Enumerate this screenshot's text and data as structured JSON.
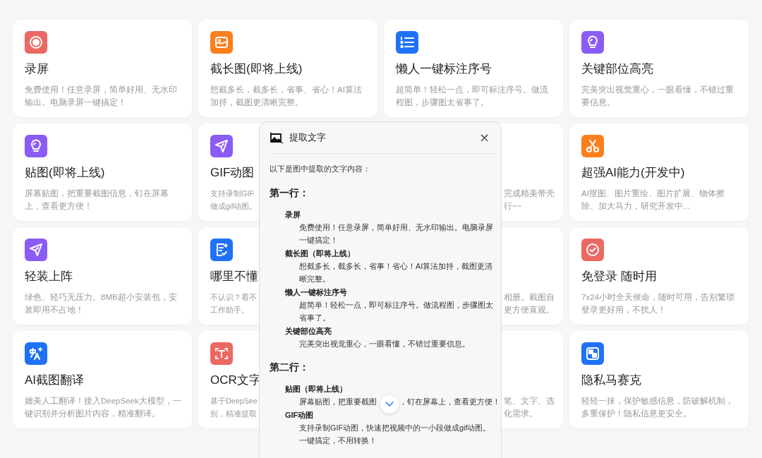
{
  "cards": [
    {
      "kind": "full",
      "color": "#eb6863",
      "title": "录屏",
      "description": "免费使用！任意录屏，简单好用、无水印输出。电脑录屏一键搞定！"
    },
    {
      "kind": "full",
      "color": "#fb7f1d",
      "title": "截长图(即将上线)",
      "description": "想截多长，截多长，省事、省心！AI算法加持，截图更清晰完整。"
    },
    {
      "kind": "full",
      "color": "#1f72f6",
      "title": "懒人一键标注序号",
      "description": "超简单！轻松一点，即可标注序号。做流程图，步骤图太省事了。"
    },
    {
      "kind": "full",
      "color": "#8a5cf5",
      "title": "关键部位高亮",
      "description": "完美突出视觉重心，一眼看懂，不错过重要信息。"
    },
    {
      "kind": "full",
      "color": "#8a5cf5",
      "title": "贴图(即将上线)",
      "description": "屏幕贴图，把重要截图信息，钉在屏幕上，查看更方便！"
    },
    {
      "kind": "covered-right",
      "color": "#8a5cf5",
      "title": "GIF动图",
      "lines": [
        "支持录制GIF",
        "做成gif动图。"
      ]
    },
    {
      "kind": "covered-left",
      "lines": [
        "完成精美带壳",
        "行~~"
      ]
    },
    {
      "kind": "full",
      "color": "#fb7f1d",
      "title": "超强AI能力(开发中)",
      "description": "AI抠图、图片重绘、图片扩展、物体擦除、加大马力，研究开发中..."
    },
    {
      "kind": "full",
      "color": "#8a5cf5",
      "title": "轻装上阵",
      "description": "绿色、轻巧无压力。8MB超小安装包，安装即用不占地！"
    },
    {
      "kind": "covered-right",
      "color": "#1f72f6",
      "title": "哪里不懂",
      "lines": [
        "不认识？看不",
        "工作助手。"
      ]
    },
    {
      "kind": "covered-left",
      "lines": [
        "相册。截图自",
        "更方便直观。"
      ]
    },
    {
      "kind": "full",
      "color": "#eb6863",
      "title": "免登录 随时用",
      "description": "7x24小时全天候命，随时可用，告别繁琐登录更好用，不扰人！"
    },
    {
      "kind": "full",
      "color": "#1f72f6",
      "title": "AI截图翻译",
      "description": "媲美人工翻译！接入DeepSeek大模型，一键识别并分析图片内容，精准翻译。"
    },
    {
      "kind": "covered-right",
      "color": "#eb6863",
      "title": "OCR文字",
      "lines": [
        "基于DeepSee",
        "别，精准提取"
      ]
    },
    {
      "kind": "covered-left",
      "lines": [
        "笔、文字、选",
        "化需求。"
      ]
    },
    {
      "kind": "full",
      "color": "#1f72f6",
      "title": "隐私马赛克",
      "description": "轻轻一抹，保护敏感信息，防破解机制，多重保护！隐私信息更安全。"
    }
  ],
  "dialog": {
    "title": "提取文字",
    "close": "×",
    "intro": "以下是图中提取的文字内容：",
    "sections": [
      {
        "heading": "第一行：",
        "items": [
          {
            "title": "录屏",
            "text": "免费使用！任意录屏，简单好用、无水印输出。电脑录屏一键搞定！"
          },
          {
            "title": "截长图（即将上线）",
            "text": "想截多长，截多长，省事！省心！AI算法加持，截图更清晰完整。"
          },
          {
            "title": "懒人一键标注序号",
            "text": "超简单！轻松一点，即可标注序号。做流程图，步骤图太省事了。"
          },
          {
            "title": "关键部位高亮",
            "text": "完美突出视觉重心，一眼看懂，不错过重要信息。"
          }
        ]
      },
      {
        "heading": "第二行：",
        "items": [
          {
            "title": "贴图（即将上线）",
            "text_parts": [
              "屏幕贴图，把重要截图",
              "，钉在屏幕上，查看更方便！"
            ]
          },
          {
            "title": "GIF动图",
            "text": "支持录制GIF动图，快速把视频中的一小段做成gif动图。一键搞定，不用转换！"
          }
        ]
      }
    ]
  }
}
